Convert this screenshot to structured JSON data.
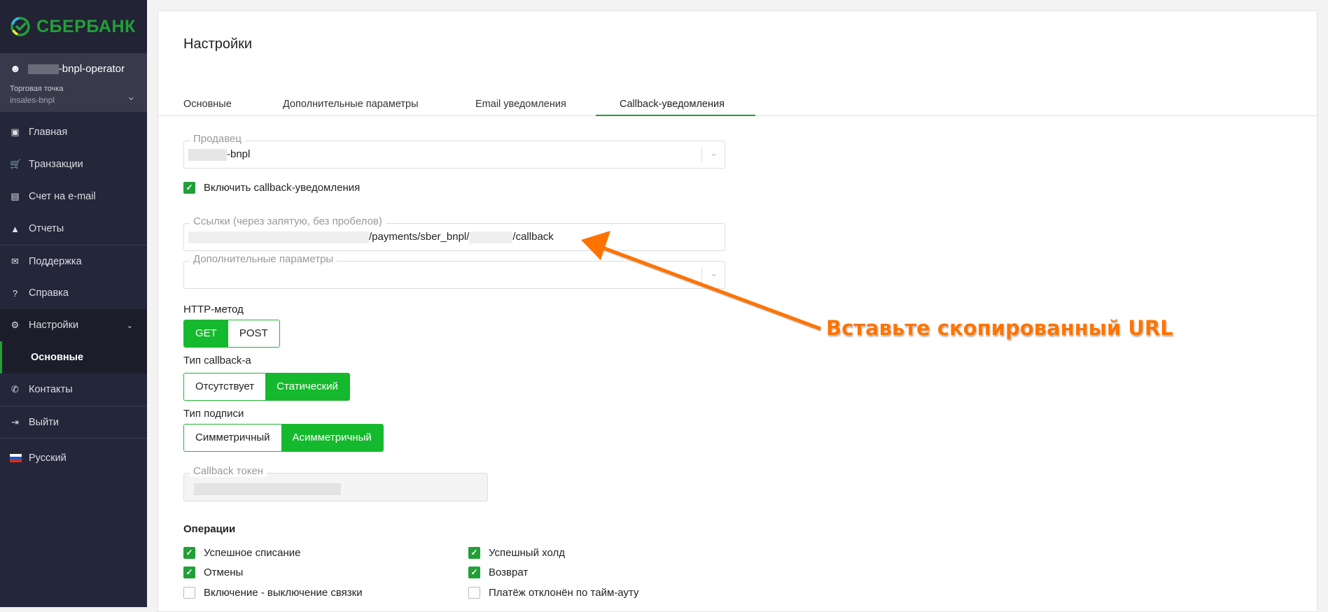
{
  "brand": {
    "logo_text": "СБЕРБАНК"
  },
  "user": {
    "name_suffix": "-bnpl-operator",
    "store_label": "Торговая точка",
    "store_value": "insales-bnpl"
  },
  "sidebar": {
    "items": [
      {
        "label": "Главная",
        "icon": "dashboard-icon"
      },
      {
        "label": "Транзакции",
        "icon": "cart-icon"
      },
      {
        "label": "Счет на e-mail",
        "icon": "invoice-icon"
      },
      {
        "label": "Отчеты",
        "icon": "chart-icon"
      },
      {
        "label": "Поддержка",
        "icon": "chat-icon"
      },
      {
        "label": "Справка",
        "icon": "help-icon"
      },
      {
        "label": "Настройки",
        "icon": "gear-icon"
      },
      {
        "label": "Основные"
      },
      {
        "label": "Контакты",
        "icon": "phone-icon"
      },
      {
        "label": "Выйти",
        "icon": "logout-icon"
      },
      {
        "label": "Русский",
        "icon": "russia-flag-icon"
      }
    ]
  },
  "page": {
    "title": "Настройки"
  },
  "tabs": [
    "Основные",
    "Дополнительные параметры",
    "Email уведомления",
    "Callback-уведомления"
  ],
  "form": {
    "seller_label": "Продавец",
    "seller_value_suffix": "-bnpl",
    "enable_callback": "Включить callback-уведомления",
    "links_label": "Ссылки (через запятую, без пробелов)",
    "links_value_mid": "/payments/sber_bnpl/",
    "links_value_end": "/callback",
    "extra_label": "Дополнительные параметры",
    "http_label": "HTTP-метод",
    "http_options": [
      "GET",
      "POST"
    ],
    "cbtype_label": "Тип callback-а",
    "cbtype_options": [
      "Отсутствует",
      "Статический"
    ],
    "sign_label": "Тип подписи",
    "sign_options": [
      "Симметричный",
      "Асимметричный"
    ],
    "token_label": "Callback токен"
  },
  "operations": {
    "title": "Операции",
    "items": [
      {
        "label": "Успешное списание",
        "checked": true
      },
      {
        "label": "Успешный холд",
        "checked": true
      },
      {
        "label": "Отмены",
        "checked": true
      },
      {
        "label": "Возврат",
        "checked": true
      },
      {
        "label": "Включение - выключение связки",
        "checked": false
      },
      {
        "label": "Платёж отклонён по тайм-ауту",
        "checked": false
      }
    ]
  },
  "annotation": {
    "text": "Вставьте скопированный URL",
    "color": "#ff7300"
  }
}
